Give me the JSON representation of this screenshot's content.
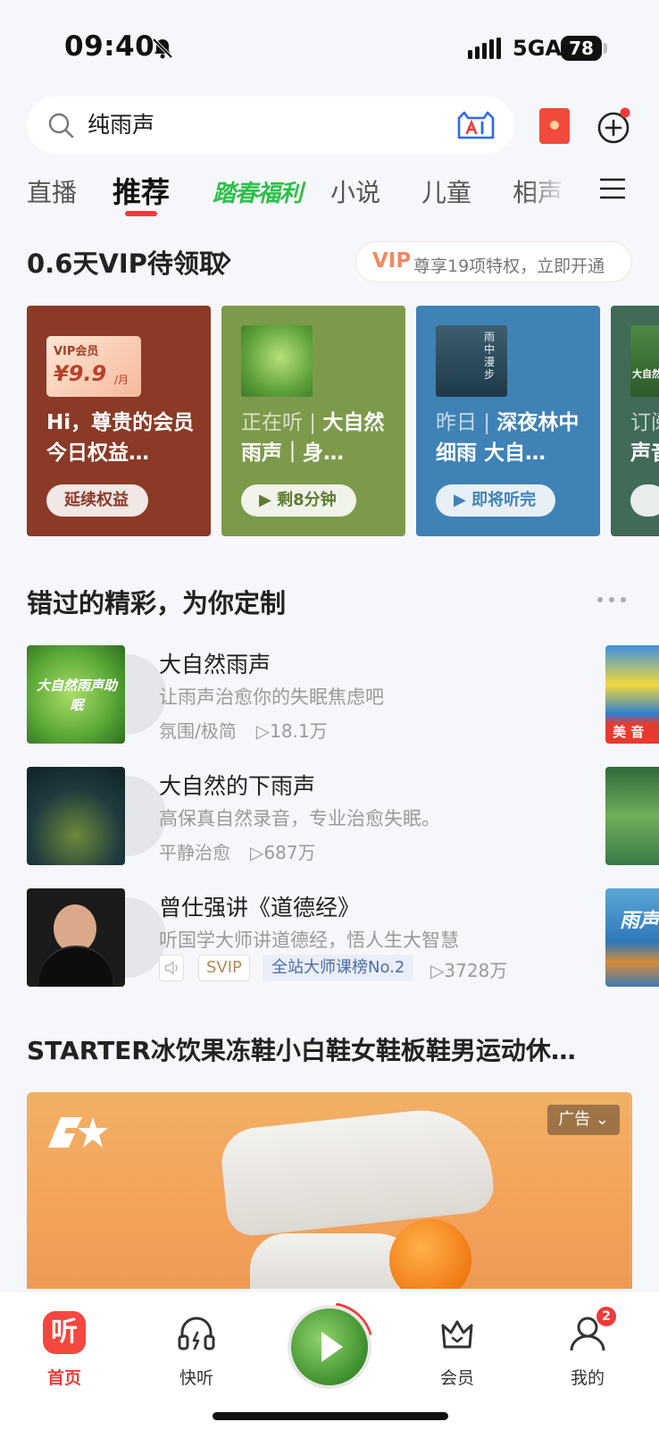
{
  "status_bar": {
    "time": "09:40",
    "network": "5GA",
    "battery": "78"
  },
  "search": {
    "value": "纯雨声"
  },
  "tabs": [
    {
      "label": "直播"
    },
    {
      "label": "推荐"
    },
    {
      "label": "踏春福利"
    },
    {
      "label": "小说"
    },
    {
      "label": "儿童"
    },
    {
      "label": "相声"
    }
  ],
  "vip_header": {
    "title": "0.6天VIP待领取",
    "pill_tag": "VIP",
    "pill_text": "尊享19项特权，立即开通"
  },
  "cards": [
    {
      "badge_top": "VIP会员",
      "badge_price": "¥9.9",
      "badge_unit": "/月",
      "title": "Hi，尊贵的会员今日权益…",
      "button": "延续权益"
    },
    {
      "prefix": "正在听",
      "title": "大自然雨声｜身…",
      "button": "▶ 剩8分钟"
    },
    {
      "prefix": "昨日",
      "title": "深夜林中细雨 大自…",
      "cover_text": "雨中漫步",
      "button": "▶ 即将听完"
    },
    {
      "prefix": "订阅",
      "title": "声音…",
      "cover_text": "大自然"
    }
  ],
  "section": {
    "title": "错过的精彩，为你定制",
    "items": [
      {
        "title": "大自然雨声",
        "desc": "让雨声治愈你的失眠焦虑吧",
        "tags": "氛围/极简",
        "plays": "▷18.1万",
        "cover_text": "大自然雨声助眠"
      },
      {
        "title": "大自然的下雨声",
        "desc": "高保真自然录音，专业治愈失眠。",
        "tags": "平静治愈",
        "plays": "▷687万"
      },
      {
        "title": "曾仕强讲《道德经》",
        "desc": "听国学大师讲道德经，悟人生大智慧",
        "svip": "SVIP",
        "rank": "全站大师课榜No.2",
        "plays": "▷3728万"
      }
    ],
    "side_texts": [
      "美 音",
      "雨声"
    ]
  },
  "ad": {
    "title": "STARTER冰饮果冻鞋小白鞋女鞋板鞋男运动休…",
    "tag": "广告"
  },
  "bottom_nav": [
    {
      "label": "首页",
      "icon_char": "听"
    },
    {
      "label": "快听"
    },
    {
      "label": "会员"
    },
    {
      "label": "我的",
      "badge": "2"
    }
  ],
  "colors": {
    "accent": "#f03a3a",
    "card1": "#8a3a26",
    "card2": "#7c9a4a",
    "card3": "#3f82b5",
    "card4": "#3f6b57"
  }
}
